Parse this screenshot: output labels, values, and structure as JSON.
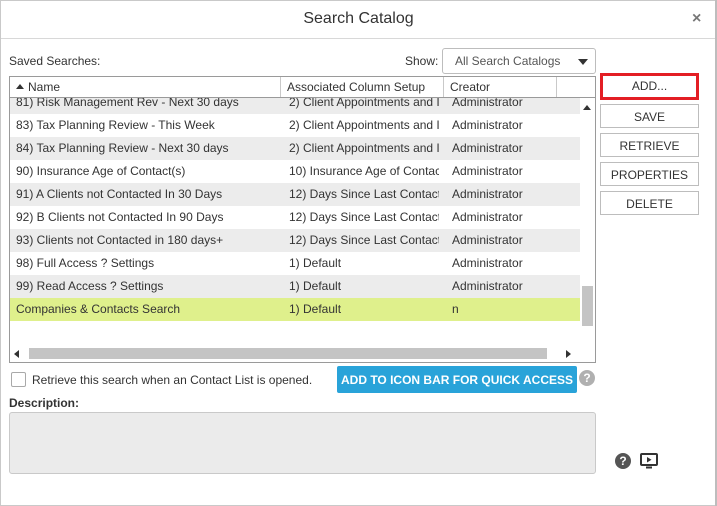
{
  "dialog": {
    "title": "Search Catalog",
    "close_icon": "close-icon",
    "close_glyph": "×"
  },
  "saved_searches_label": "Saved Searches:",
  "show": {
    "label": "Show:",
    "selected": "All Search Catalogs",
    "icon": "chevron-down-icon"
  },
  "grid": {
    "columns": [
      "Name",
      "Associated Column Setup",
      "Creator"
    ],
    "sort_icon": "sort-ascending-icon",
    "rows": [
      {
        "name": "81) Risk Management Rev - Next 30 days",
        "setup": "2) Client Appointments and I",
        "creator": "Administrator"
      },
      {
        "name": "83) Tax Planning Review - This Week",
        "setup": "2) Client Appointments and I",
        "creator": "Administrator"
      },
      {
        "name": "84) Tax Planning Review - Next 30 days",
        "setup": "2) Client Appointments and I",
        "creator": "Administrator"
      },
      {
        "name": "90) Insurance Age of Contact(s)",
        "setup": "10) Insurance Age of Contac",
        "creator": "Administrator"
      },
      {
        "name": "91) A Clients not Contacted In 30 Days",
        "setup": "12) Days Since Last Contact",
        "creator": "Administrator"
      },
      {
        "name": "92) B Clients not Contacted In 90 Days",
        "setup": "12) Days Since Last Contact",
        "creator": "Administrator"
      },
      {
        "name": "93) Clients not Contacted in 180 days+",
        "setup": "12) Days Since Last Contact",
        "creator": "Administrator"
      },
      {
        "name": "98) Full Access ? Settings",
        "setup": "1) Default",
        "creator": "Administrator"
      },
      {
        "name": "99) Read Access ? Settings",
        "setup": "1) Default",
        "creator": "Administrator"
      },
      {
        "name": "Companies & Contacts Search",
        "setup": "1) Default",
        "creator": "n"
      }
    ],
    "selected_row_index": 9,
    "selected_color": "#dff08c"
  },
  "buttons": {
    "add": "ADD...",
    "save": "SAVE",
    "retrieve": "RETRIEVE",
    "properties": "PROPERTIES",
    "delete": "DELETE",
    "add_highlight_color": "#e31e24"
  },
  "retrieve_on_open": {
    "label": "Retrieve this search when an Contact List is opened.",
    "checked": false
  },
  "icon_bar_button": {
    "label": "ADD TO ICON BAR FOR QUICK ACCESS",
    "color": "#29a3d9"
  },
  "help_icon": "help-icon",
  "help_glyph": "?",
  "description": {
    "label": "Description:",
    "value": ""
  },
  "video_icon": "video-icon"
}
